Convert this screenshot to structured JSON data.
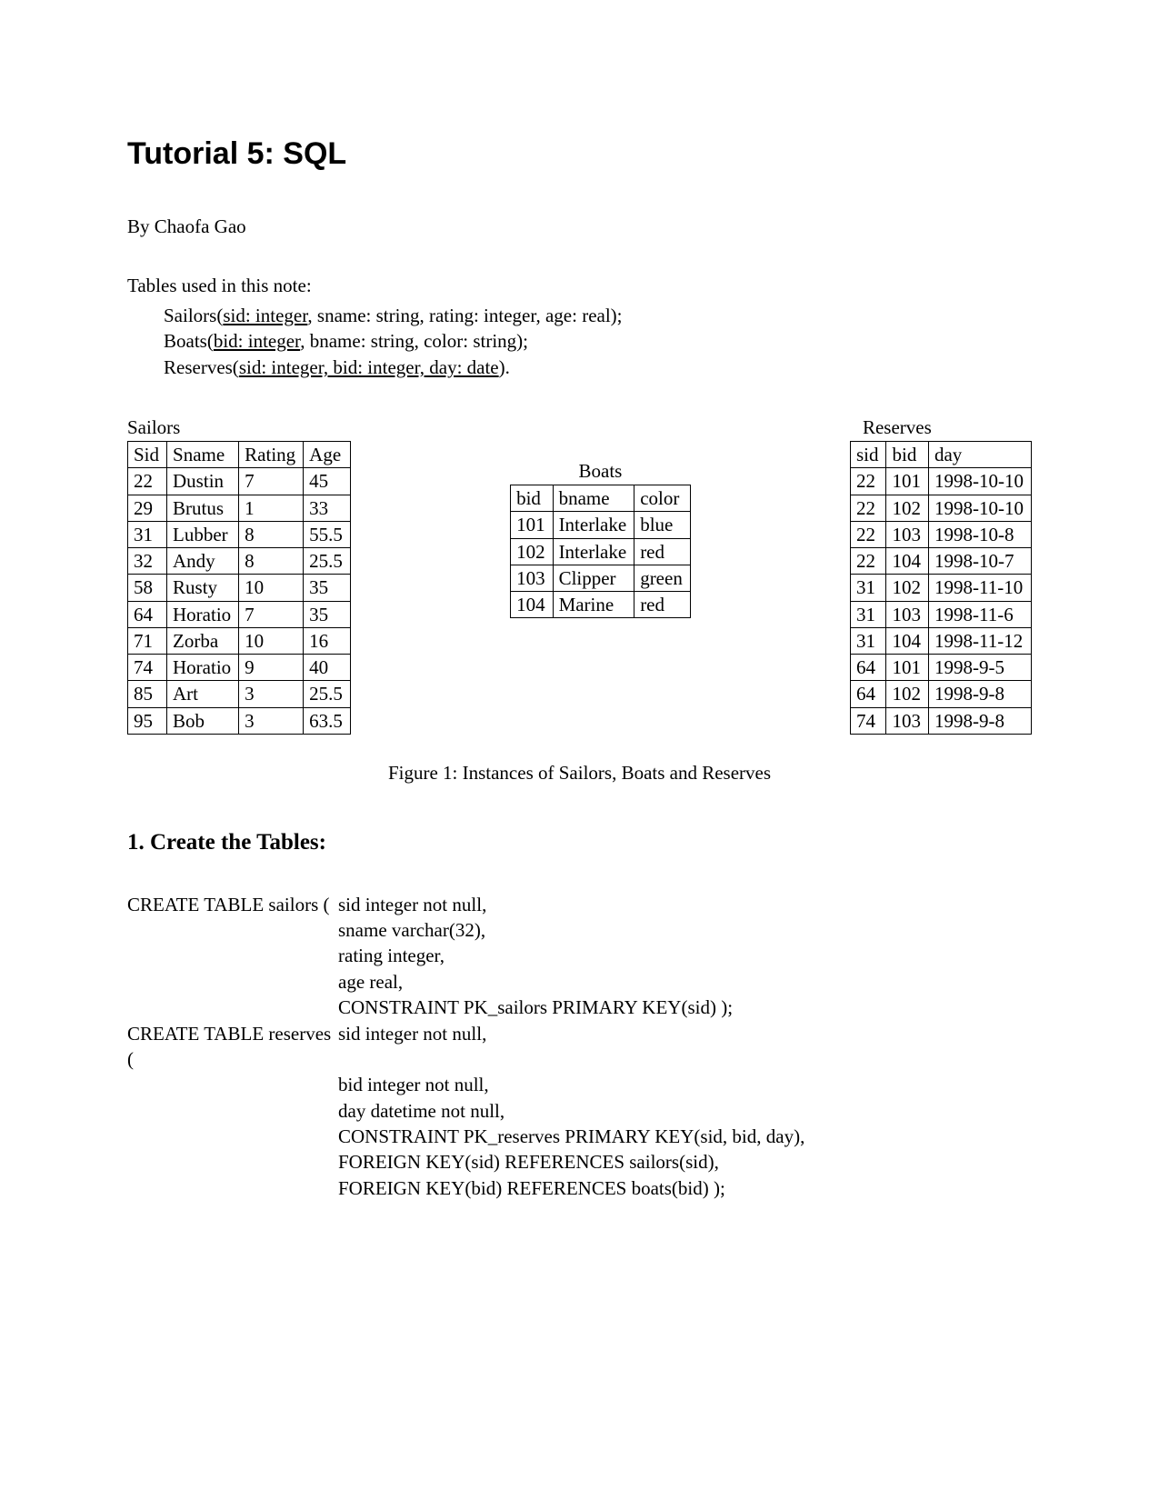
{
  "title": "Tutorial 5: SQL",
  "author": "By Chaofa Gao",
  "intro": "Tables used in this note:",
  "schemas": {
    "sailors": {
      "pre": "Sailors(",
      "key": "sid: integer",
      "rest": ", sname: string, rating: integer, age: real);"
    },
    "boats": {
      "pre": "Boats(",
      "key": "bid: integer",
      "rest": ", bname: string, color: string);"
    },
    "reserves": {
      "pre": "Reserves(",
      "key": "sid: integer, bid: integer, day: date",
      "rest": ")."
    }
  },
  "sailors": {
    "label": "Sailors",
    "headers": [
      "Sid",
      "Sname",
      "Rating",
      "Age"
    ],
    "rows": [
      [
        "22",
        "Dustin",
        "7",
        "45"
      ],
      [
        "29",
        "Brutus",
        "1",
        "33"
      ],
      [
        "31",
        "Lubber",
        "8",
        "55.5"
      ],
      [
        "32",
        "Andy",
        "8",
        "25.5"
      ],
      [
        "58",
        "Rusty",
        "10",
        "35"
      ],
      [
        "64",
        "Horatio",
        "7",
        "35"
      ],
      [
        "71",
        "Zorba",
        "10",
        "16"
      ],
      [
        "74",
        "Horatio",
        "9",
        "40"
      ],
      [
        "85",
        "Art",
        "3",
        "25.5"
      ],
      [
        "95",
        "Bob",
        "3",
        "63.5"
      ]
    ]
  },
  "boats": {
    "label": "Boats",
    "headers": [
      "bid",
      "bname",
      "color"
    ],
    "rows": [
      [
        "101",
        "Interlake",
        "blue"
      ],
      [
        "102",
        "Interlake",
        "red"
      ],
      [
        "103",
        "Clipper",
        "green"
      ],
      [
        "104",
        "Marine",
        "red"
      ]
    ]
  },
  "reserves": {
    "label": "Reserves",
    "headers": [
      "sid",
      "bid",
      "day"
    ],
    "rows": [
      [
        "22",
        "101",
        "1998-10-10"
      ],
      [
        "22",
        "102",
        "1998-10-10"
      ],
      [
        "22",
        "103",
        "1998-10-8"
      ],
      [
        "22",
        "104",
        "1998-10-7"
      ],
      [
        "31",
        "102",
        "1998-11-10"
      ],
      [
        "31",
        "103",
        "1998-11-6"
      ],
      [
        "31",
        "104",
        "1998-11-12"
      ],
      [
        "64",
        "101",
        "1998-9-5"
      ],
      [
        "64",
        "102",
        "1998-9-8"
      ],
      [
        "74",
        "103",
        "1998-9-8"
      ]
    ]
  },
  "figure_caption": "Figure 1: Instances of Sailors, Boats and Reserves",
  "section1": "1. Create the Tables:",
  "sql": {
    "sailors": {
      "head": "CREATE TABLE sailors (",
      "lines": [
        "sid integer not null,",
        "sname varchar(32),",
        "rating integer,",
        "age real,",
        "CONSTRAINT PK_sailors PRIMARY KEY(sid) );"
      ]
    },
    "reserves": {
      "head": "CREATE TABLE reserves (",
      "lines": [
        "sid integer not null,",
        "bid integer not null,",
        "day datetime not null,",
        "CONSTRAINT PK_reserves PRIMARY KEY(sid, bid, day),",
        "FOREIGN KEY(sid) REFERENCES sailors(sid),",
        "FOREIGN KEY(bid) REFERENCES boats(bid) );"
      ]
    }
  }
}
